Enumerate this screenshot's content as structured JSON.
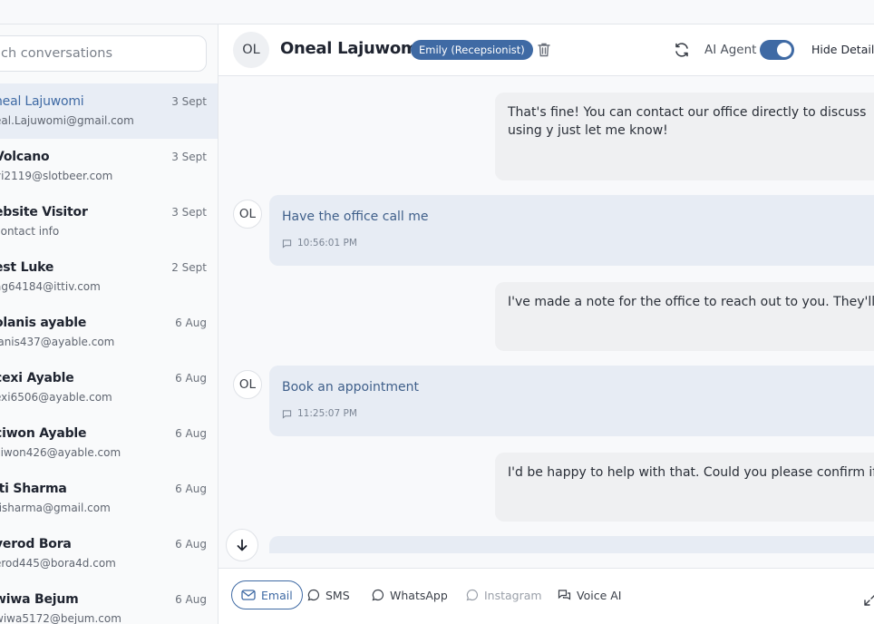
{
  "search": {
    "placeholder": "Search conversations",
    "visible": "ch conversations"
  },
  "conversations": [
    {
      "name": "neal Lajuwomi",
      "email": "eal.Lajuwomi@gmail.com",
      "date": "3 Sept",
      "active": true
    },
    {
      "name": "Volcano",
      "email": "yi2119@slotbeer.com",
      "date": "3 Sept"
    },
    {
      "name": "ebsite Visitor",
      "email": "contact info",
      "date": "3 Sept"
    },
    {
      "name": "est Luke",
      "email": "ag64184@ittiv.com",
      "date": "2 Sept"
    },
    {
      "name": "olanis ayable",
      "email": "lanis437@ayable.com",
      "date": "6 Aug"
    },
    {
      "name": "cexi Ayable",
      "email": "exi6506@ayable.com",
      "date": "6 Aug"
    },
    {
      "name": "ciwon Ayable",
      "email": "ciwon426@ayable.com",
      "date": "6 Aug"
    },
    {
      "name": "iti Sharma",
      "email": "tisharma@gmail.com",
      "date": "6 Aug"
    },
    {
      "name": "yerod Bora",
      "email": "erod445@bora4d.com",
      "date": "6 Aug"
    },
    {
      "name": "wiwa Bejum",
      "email": "wiwa5172@bejum.com",
      "date": "6 Aug"
    }
  ],
  "header": {
    "initials": "OL",
    "contact_name": "Oneal Lajuwomi",
    "agent_badge": "Emily (Recepsionist)",
    "ai_agent_label": "AI Agent",
    "ai_agent_enabled": true,
    "hide_details": "Hide Details"
  },
  "messages": [
    {
      "direction": "out",
      "text": "That's fine! You can contact our office directly to discuss using y just let me know!"
    },
    {
      "direction": "in",
      "initials": "OL",
      "text": "Have the office call me",
      "time": "10:56:01 PM"
    },
    {
      "direction": "out",
      "text": "I've made a note for the office to reach out to you. They'll be in to"
    },
    {
      "direction": "in",
      "initials": "OL",
      "text": "Book an appointment",
      "time": "11:25:07 PM"
    },
    {
      "direction": "out",
      "text": "I'd be happy to help with that. Could you please confirm if you'd"
    }
  ],
  "channels": [
    {
      "label": "Email",
      "icon": "mail-icon",
      "state": "active"
    },
    {
      "label": "SMS",
      "icon": "chat-bubble-icon",
      "state": "normal"
    },
    {
      "label": "WhatsApp",
      "icon": "whatsapp-icon",
      "state": "normal"
    },
    {
      "label": "Instagram",
      "icon": "instagram-icon",
      "state": "disabled"
    },
    {
      "label": "Voice AI",
      "icon": "voice-ai-icon",
      "state": "normal"
    }
  ],
  "colors": {
    "accent": "#3f6aa4",
    "active_row": "#e8edf5",
    "incoming_bubble": "#e7ecf4",
    "outgoing_bubble": "#eff0f2"
  }
}
